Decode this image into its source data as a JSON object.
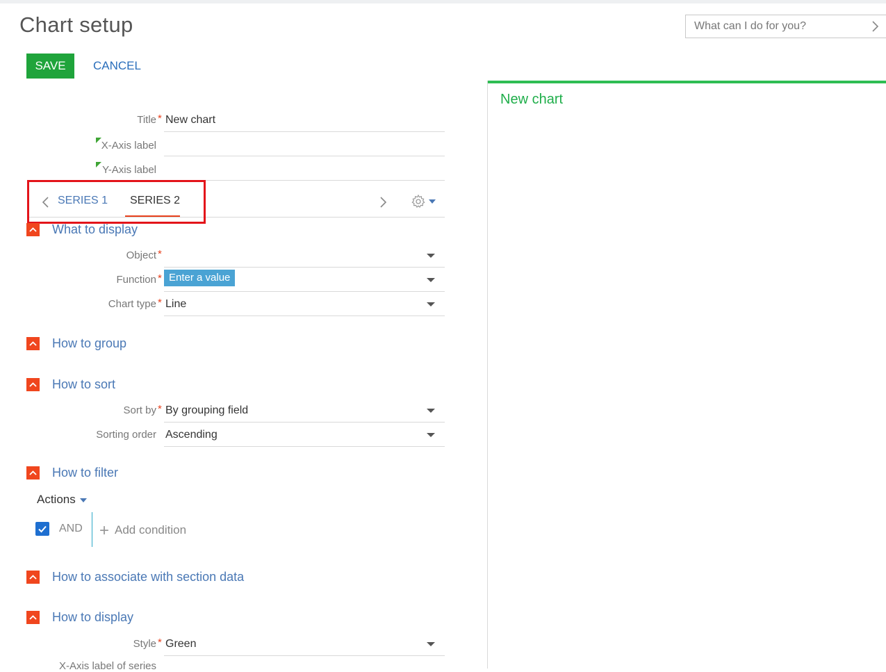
{
  "page": {
    "title": "Chart setup"
  },
  "toolbar": {
    "save_label": "SAVE",
    "cancel_label": "CANCEL"
  },
  "command_line": {
    "placeholder": "What can I do for you?"
  },
  "general": {
    "title_label": "Title",
    "title_value": "New chart",
    "x_axis_label": "X-Axis label",
    "x_axis_value": "",
    "y_axis_label": "Y-Axis label",
    "y_axis_value": ""
  },
  "series_tabs": {
    "tabs": [
      "SERIES 1",
      "SERIES 2"
    ],
    "active": "SERIES 2"
  },
  "sections": {
    "what_to_display": {
      "title": "What to display",
      "object_label": "Object",
      "object_value": "",
      "function_label": "Function",
      "function_value": "Enter a value",
      "chart_type_label": "Chart type",
      "chart_type_value": "Line"
    },
    "how_to_group": {
      "title": "How to group"
    },
    "how_to_sort": {
      "title": "How to sort",
      "sort_by_label": "Sort by",
      "sort_by_value": "By grouping field",
      "sorting_order_label": "Sorting order",
      "sorting_order_value": "Ascending"
    },
    "how_to_filter": {
      "title": "How to filter",
      "actions_label": "Actions",
      "and_label": "AND",
      "and_checked": true,
      "add_condition_label": "Add condition"
    },
    "how_to_associate": {
      "title": "How to associate with section data"
    },
    "how_to_display": {
      "title": "How to display",
      "style_label": "Style",
      "style_value": "Green",
      "x_axis_series_label": "X-Axis label of series"
    }
  },
  "preview": {
    "chart_title": "New chart",
    "accent_color": "#2ebd53"
  },
  "colors": {
    "save": "#1fa43b",
    "link": "#2a6ebb",
    "section_icon": "#f0461e",
    "required": "#e8401c",
    "highlight": "#e3141a"
  }
}
